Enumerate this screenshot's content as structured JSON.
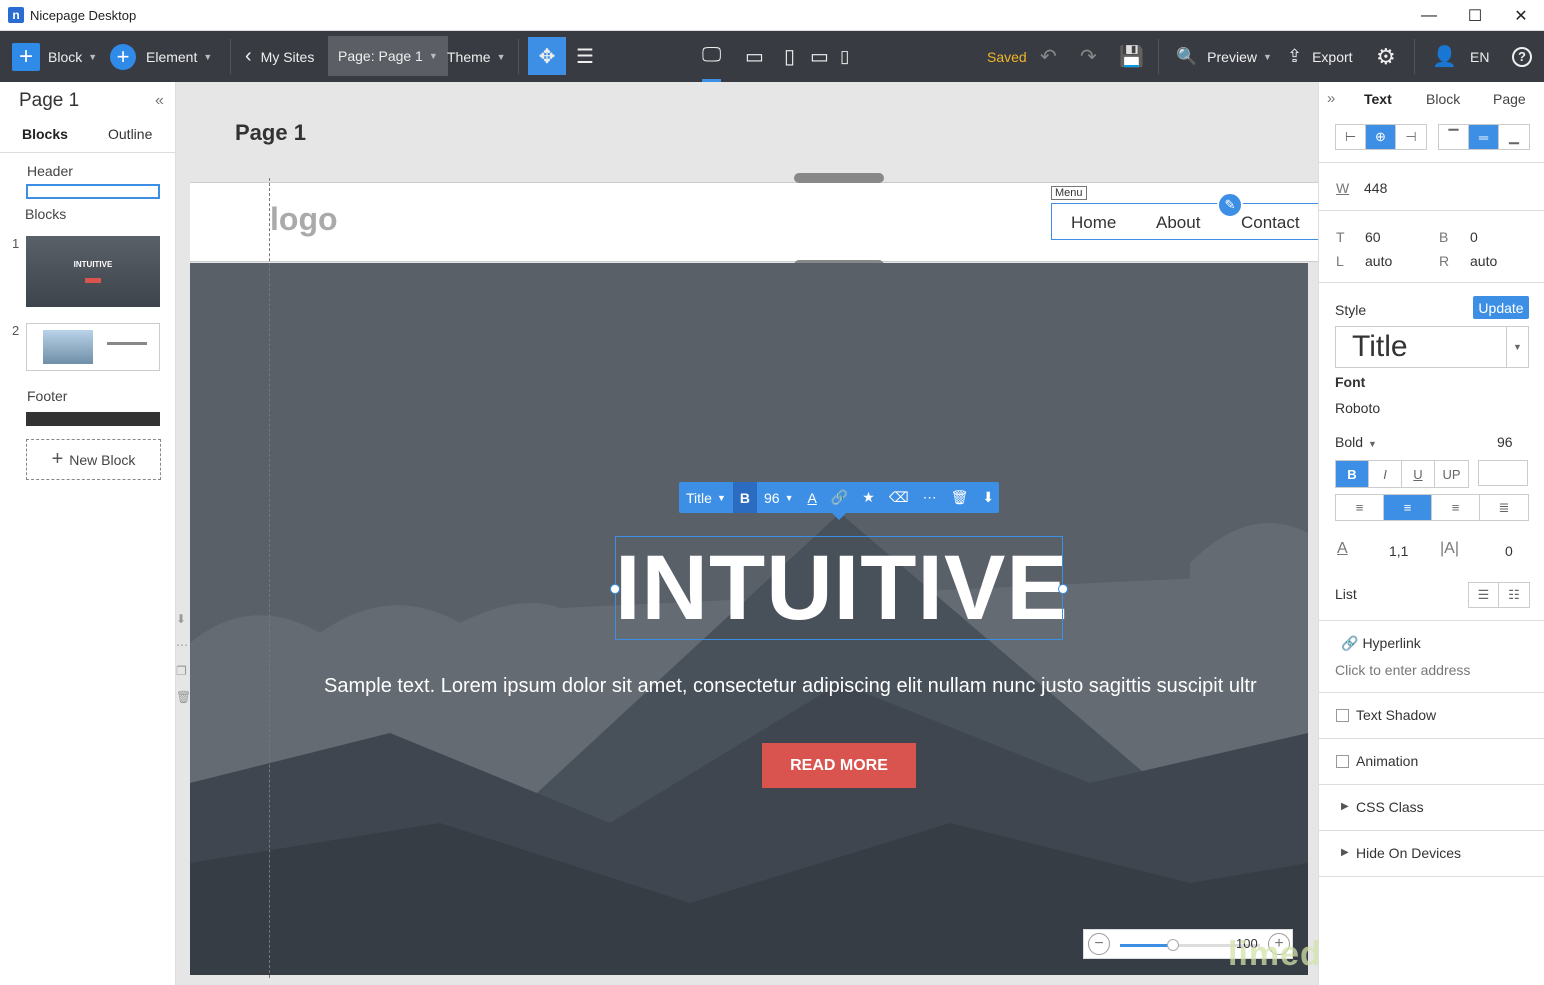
{
  "window": {
    "title": "Nicepage Desktop",
    "app_icon": "n",
    "minimize": "—",
    "maximize": "☐",
    "close": "✕"
  },
  "toolbar": {
    "block_label": "Block",
    "element_label": "Element",
    "my_sites_label": "My Sites",
    "page_label": "Page: Page 1",
    "theme_label": "Theme",
    "saved_label": "Saved",
    "preview_label": "Preview",
    "export_label": "Export",
    "lang_label": "EN",
    "help_label": "?"
  },
  "left_panel": {
    "title": "Page 1",
    "tabs": [
      "Blocks",
      "Outline"
    ],
    "header_label": "Header",
    "blocks_label": "Blocks",
    "block_thumbs": [
      {
        "num": "1",
        "title": "INTUITIVE"
      },
      {
        "num": "2"
      }
    ],
    "footer_label": "Footer",
    "new_block_label": "New Block"
  },
  "canvas": {
    "page_title": "Page 1",
    "logo_text": "logo",
    "menu_tag": "Menu",
    "menu_items": [
      "Home",
      "About",
      "Contact"
    ],
    "text_toolbar": {
      "style": "Title",
      "bold": "B",
      "size": "96"
    },
    "hero_title": "INTUITIVE",
    "hero_text": "Sample text. Lorem ipsum dolor sit amet, consectetur adipiscing elit nullam nunc justo sagittis suscipit ultr",
    "hero_button": "READ MORE",
    "hero_bg_color": "#596068",
    "button_color": "#d9534f",
    "zoom_value": "100",
    "zoom_level": 0.38
  },
  "right_panel": {
    "tabs": [
      "Text",
      "Block",
      "Page"
    ],
    "width_label": "W",
    "width_value": "448",
    "top_label": "T",
    "top_value": "60",
    "bottom_label": "B",
    "bottom_value": "0",
    "left_label": "L",
    "left_value": "auto",
    "right_label": "R",
    "right_value": "auto",
    "style_label": "Style",
    "update_label": "Update",
    "style_value": "Title",
    "font_label": "Font",
    "font_value": "Roboto",
    "weight_label": "Bold",
    "size_value": "96",
    "format_buttons": [
      "B",
      "I",
      "U",
      "UP"
    ],
    "line_height_label": "A",
    "line_height_value": "1,1",
    "letter_spacing_label": "|A|",
    "letter_spacing_value": "0",
    "list_label": "List",
    "hyperlink_label": "Hyperlink",
    "hyperlink_placeholder": "Click to enter address",
    "text_shadow_label": "Text Shadow",
    "animation_label": "Animation",
    "css_class_label": "CSS Class",
    "hide_devices_label": "Hide On Devices"
  },
  "watermark": "limedownload.com",
  "accent_color": "#3d8fe6"
}
